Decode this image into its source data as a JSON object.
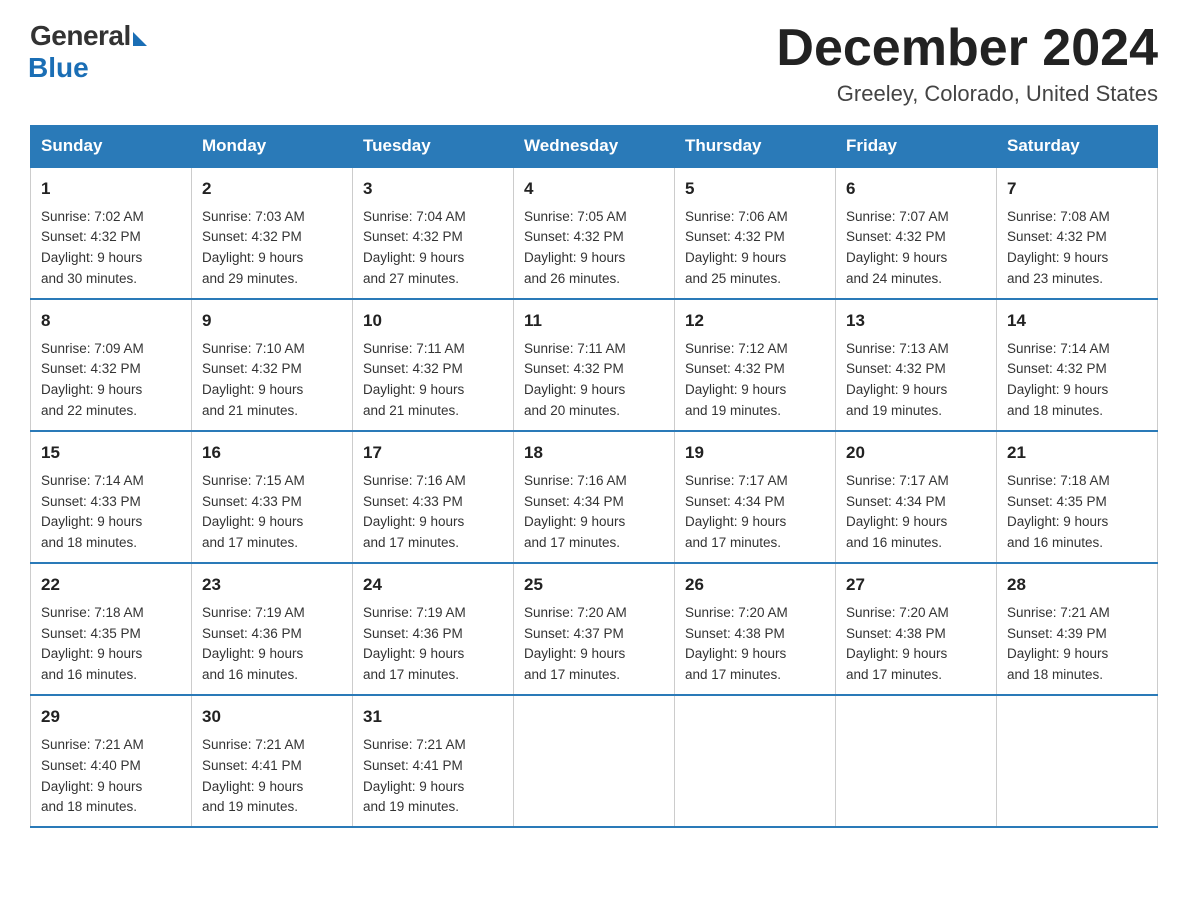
{
  "logo": {
    "general": "General",
    "blue": "Blue"
  },
  "title": "December 2024",
  "location": "Greeley, Colorado, United States",
  "weekdays": [
    "Sunday",
    "Monday",
    "Tuesday",
    "Wednesday",
    "Thursday",
    "Friday",
    "Saturday"
  ],
  "weeks": [
    [
      {
        "day": "1",
        "sunrise": "7:02 AM",
        "sunset": "4:32 PM",
        "daylight": "9 hours and 30 minutes."
      },
      {
        "day": "2",
        "sunrise": "7:03 AM",
        "sunset": "4:32 PM",
        "daylight": "9 hours and 29 minutes."
      },
      {
        "day": "3",
        "sunrise": "7:04 AM",
        "sunset": "4:32 PM",
        "daylight": "9 hours and 27 minutes."
      },
      {
        "day": "4",
        "sunrise": "7:05 AM",
        "sunset": "4:32 PM",
        "daylight": "9 hours and 26 minutes."
      },
      {
        "day": "5",
        "sunrise": "7:06 AM",
        "sunset": "4:32 PM",
        "daylight": "9 hours and 25 minutes."
      },
      {
        "day": "6",
        "sunrise": "7:07 AM",
        "sunset": "4:32 PM",
        "daylight": "9 hours and 24 minutes."
      },
      {
        "day": "7",
        "sunrise": "7:08 AM",
        "sunset": "4:32 PM",
        "daylight": "9 hours and 23 minutes."
      }
    ],
    [
      {
        "day": "8",
        "sunrise": "7:09 AM",
        "sunset": "4:32 PM",
        "daylight": "9 hours and 22 minutes."
      },
      {
        "day": "9",
        "sunrise": "7:10 AM",
        "sunset": "4:32 PM",
        "daylight": "9 hours and 21 minutes."
      },
      {
        "day": "10",
        "sunrise": "7:11 AM",
        "sunset": "4:32 PM",
        "daylight": "9 hours and 21 minutes."
      },
      {
        "day": "11",
        "sunrise": "7:11 AM",
        "sunset": "4:32 PM",
        "daylight": "9 hours and 20 minutes."
      },
      {
        "day": "12",
        "sunrise": "7:12 AM",
        "sunset": "4:32 PM",
        "daylight": "9 hours and 19 minutes."
      },
      {
        "day": "13",
        "sunrise": "7:13 AM",
        "sunset": "4:32 PM",
        "daylight": "9 hours and 19 minutes."
      },
      {
        "day": "14",
        "sunrise": "7:14 AM",
        "sunset": "4:32 PM",
        "daylight": "9 hours and 18 minutes."
      }
    ],
    [
      {
        "day": "15",
        "sunrise": "7:14 AM",
        "sunset": "4:33 PM",
        "daylight": "9 hours and 18 minutes."
      },
      {
        "day": "16",
        "sunrise": "7:15 AM",
        "sunset": "4:33 PM",
        "daylight": "9 hours and 17 minutes."
      },
      {
        "day": "17",
        "sunrise": "7:16 AM",
        "sunset": "4:33 PM",
        "daylight": "9 hours and 17 minutes."
      },
      {
        "day": "18",
        "sunrise": "7:16 AM",
        "sunset": "4:34 PM",
        "daylight": "9 hours and 17 minutes."
      },
      {
        "day": "19",
        "sunrise": "7:17 AM",
        "sunset": "4:34 PM",
        "daylight": "9 hours and 17 minutes."
      },
      {
        "day": "20",
        "sunrise": "7:17 AM",
        "sunset": "4:34 PM",
        "daylight": "9 hours and 16 minutes."
      },
      {
        "day": "21",
        "sunrise": "7:18 AM",
        "sunset": "4:35 PM",
        "daylight": "9 hours and 16 minutes."
      }
    ],
    [
      {
        "day": "22",
        "sunrise": "7:18 AM",
        "sunset": "4:35 PM",
        "daylight": "9 hours and 16 minutes."
      },
      {
        "day": "23",
        "sunrise": "7:19 AM",
        "sunset": "4:36 PM",
        "daylight": "9 hours and 16 minutes."
      },
      {
        "day": "24",
        "sunrise": "7:19 AM",
        "sunset": "4:36 PM",
        "daylight": "9 hours and 17 minutes."
      },
      {
        "day": "25",
        "sunrise": "7:20 AM",
        "sunset": "4:37 PM",
        "daylight": "9 hours and 17 minutes."
      },
      {
        "day": "26",
        "sunrise": "7:20 AM",
        "sunset": "4:38 PM",
        "daylight": "9 hours and 17 minutes."
      },
      {
        "day": "27",
        "sunrise": "7:20 AM",
        "sunset": "4:38 PM",
        "daylight": "9 hours and 17 minutes."
      },
      {
        "day": "28",
        "sunrise": "7:21 AM",
        "sunset": "4:39 PM",
        "daylight": "9 hours and 18 minutes."
      }
    ],
    [
      {
        "day": "29",
        "sunrise": "7:21 AM",
        "sunset": "4:40 PM",
        "daylight": "9 hours and 18 minutes."
      },
      {
        "day": "30",
        "sunrise": "7:21 AM",
        "sunset": "4:41 PM",
        "daylight": "9 hours and 19 minutes."
      },
      {
        "day": "31",
        "sunrise": "7:21 AM",
        "sunset": "4:41 PM",
        "daylight": "9 hours and 19 minutes."
      },
      null,
      null,
      null,
      null
    ]
  ]
}
